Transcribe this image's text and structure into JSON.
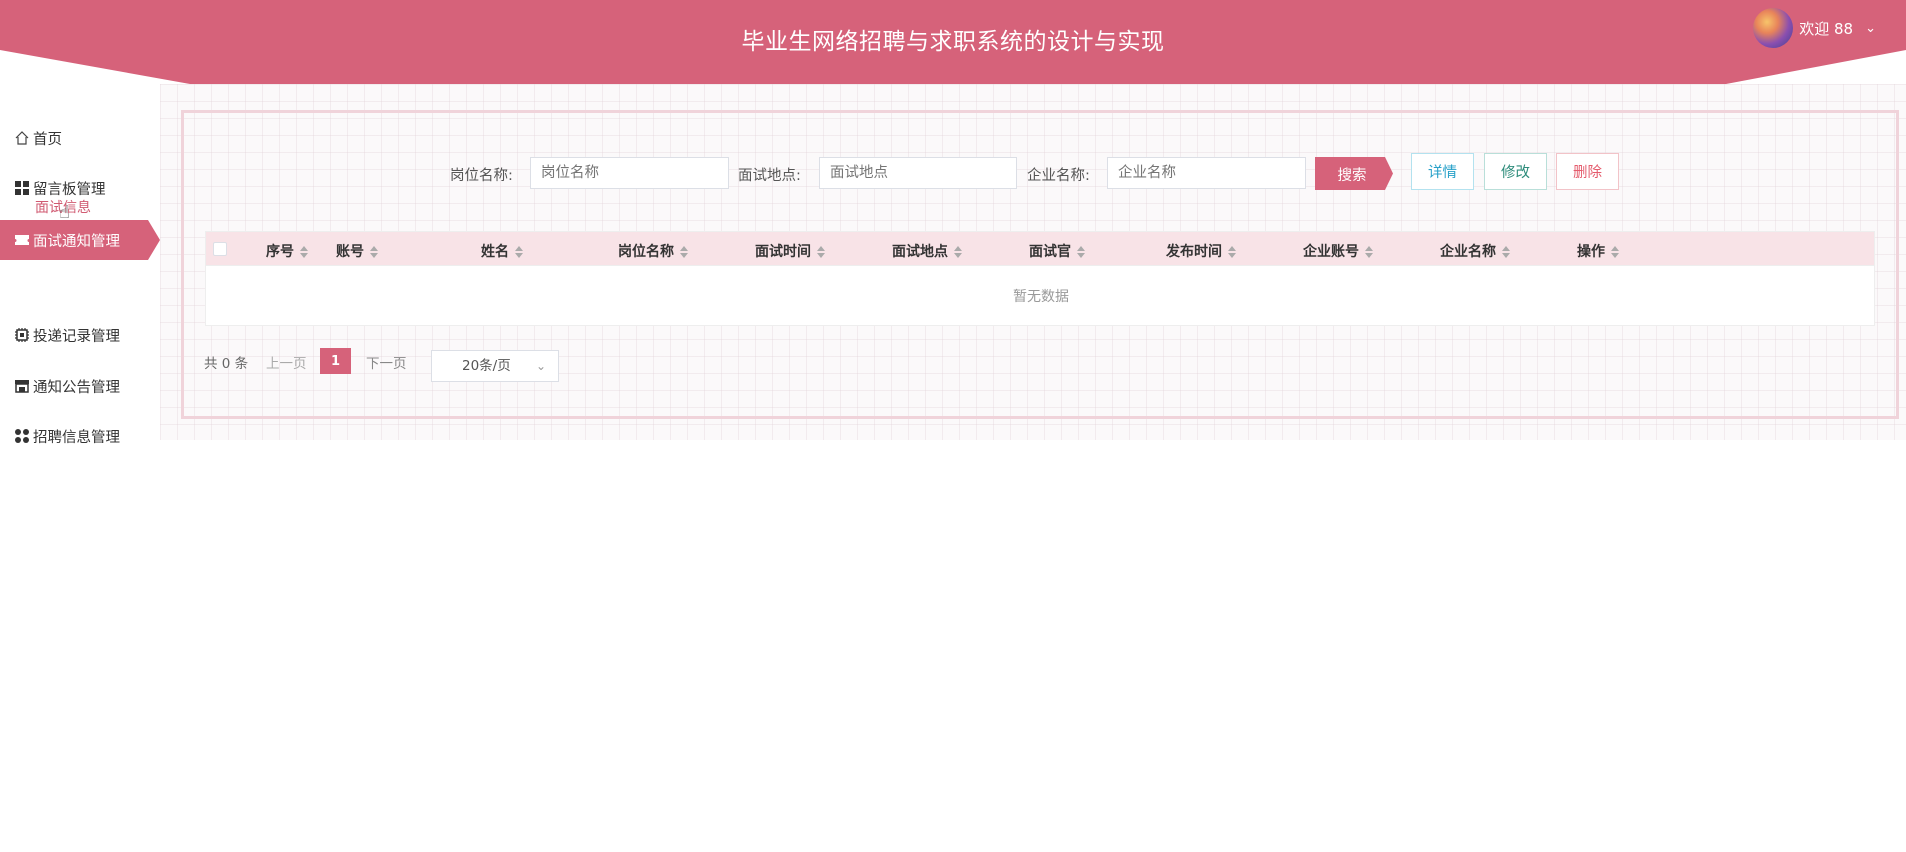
{
  "header": {
    "title": "毕业生网络招聘与求职系统的设计与实现",
    "welcome": "欢迎 88"
  },
  "colors": {
    "brand": "#d6627a",
    "accent_text": "#d05a71"
  },
  "sidebar": {
    "items": [
      {
        "label": "首页",
        "icon": "home-icon"
      },
      {
        "label": "留言板管理",
        "icon": "grid-icon"
      },
      {
        "label": "面试通知管理",
        "icon": "ticket-icon",
        "active": true
      },
      {
        "label": "投递记录管理",
        "icon": "chip-icon"
      },
      {
        "label": "通知公告管理",
        "icon": "store-icon"
      },
      {
        "label": "招聘信息管理",
        "icon": "apps-icon"
      }
    ],
    "sub_item": "面试信息"
  },
  "search": {
    "job_label": "岗位名称:",
    "job_placeholder": "岗位名称",
    "place_label": "面试地点:",
    "place_placeholder": "面试地点",
    "company_label": "企业名称:",
    "company_placeholder": "企业名称",
    "search_button": "搜索",
    "detail_button": "详情",
    "edit_button": "修改",
    "delete_button": "删除"
  },
  "table": {
    "columns": [
      "序号",
      "账号",
      "姓名",
      "岗位名称",
      "面试时间",
      "面试地点",
      "面试官",
      "发布时间",
      "企业账号",
      "企业名称",
      "操作"
    ],
    "empty_text": "暂无数据"
  },
  "pagination": {
    "total": "共 0 条",
    "prev": "上一页",
    "current": "1",
    "next": "下一页",
    "page_size": "20条/页"
  }
}
